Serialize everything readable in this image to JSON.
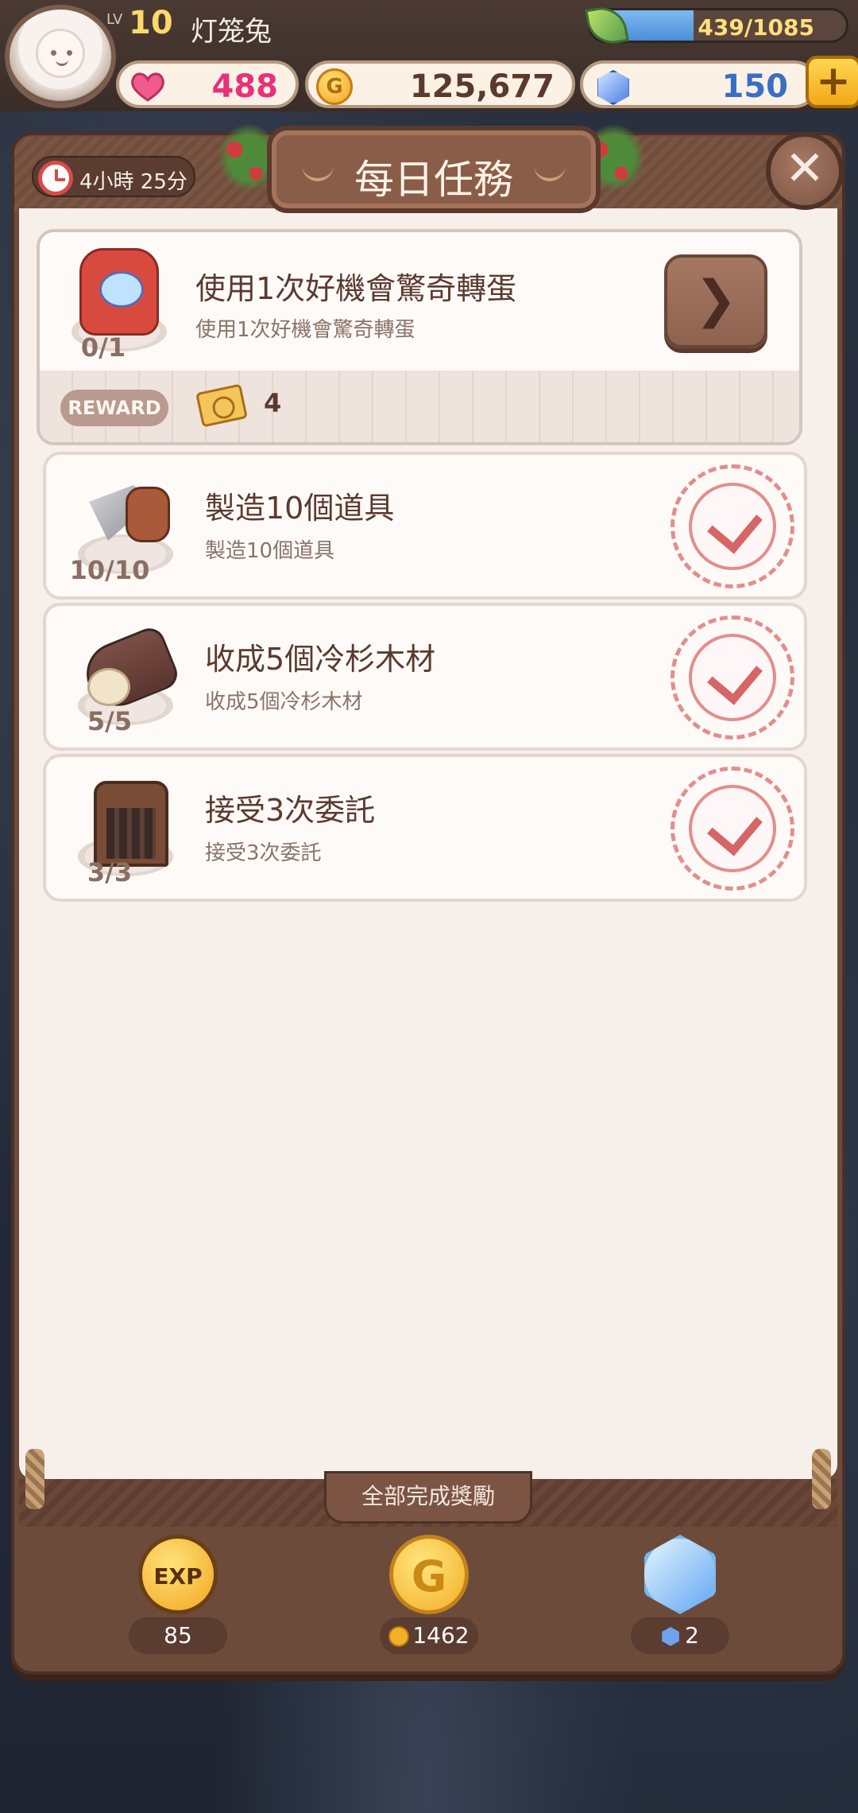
{
  "player": {
    "level_label": "LV",
    "level": "10",
    "name": "灯笼兔",
    "exp_text": "439/1085",
    "exp_fraction": 0.405
  },
  "resources": {
    "hearts": "488",
    "gold": "125,677",
    "gems": "150",
    "plus_label": "+"
  },
  "panel": {
    "title": "每日任務",
    "timer": "4小時 25分",
    "close_label": "✕"
  },
  "tasks": [
    {
      "title": "使用1次好機會驚奇轉蛋",
      "subtitle": "使用1次好機會驚奇轉蛋",
      "progress": "0/1",
      "status": "in-progress",
      "go_label": "❯",
      "reward_label": "REWARD",
      "reward_qty": "4",
      "reward_icon": "ticket-icon"
    },
    {
      "title": "製造10個道具",
      "subtitle": "製造10個道具",
      "progress": "10/10",
      "status": "completed"
    },
    {
      "title": "收成5個冷杉木材",
      "subtitle": "收成5個冷杉木材",
      "progress": "5/5",
      "status": "completed"
    },
    {
      "title": "接受3次委託",
      "subtitle": "接受3次委託",
      "progress": "3/3",
      "status": "completed"
    }
  ],
  "completion_rewards": {
    "label": "全部完成獎勵",
    "exp_icon_text": "EXP",
    "exp": "85",
    "gold_icon_text": "G",
    "gold": "1462",
    "crystal": "2"
  },
  "colors": {
    "panel_brown": "#6d4b3b",
    "panel_body": "#f7efea",
    "stamp_red": "#d86565",
    "gold": "#f2ae22"
  }
}
